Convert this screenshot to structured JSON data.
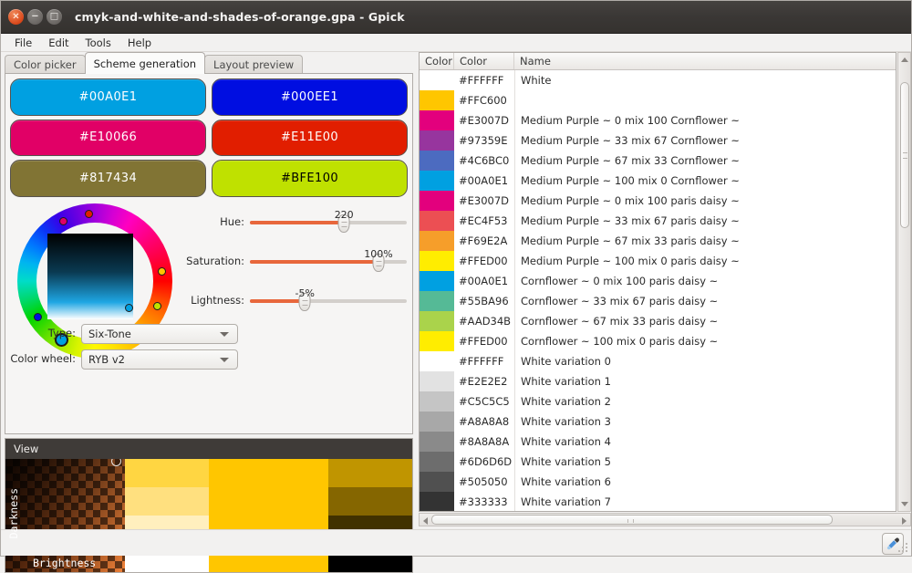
{
  "window": {
    "title": "cmyk-and-white-and-shades-of-orange.gpa - Gpick",
    "close_label": "×",
    "minimize_label": "−",
    "maximize_label": "□"
  },
  "menu": {
    "items": [
      "File",
      "Edit",
      "Tools",
      "Help"
    ]
  },
  "tabs": [
    {
      "label": "Color picker",
      "active": false
    },
    {
      "label": "Scheme generation",
      "active": true
    },
    {
      "label": "Layout preview",
      "active": false
    }
  ],
  "scheme": {
    "swatches": [
      {
        "hex": "#00A0E1",
        "text_color": "#ffffff"
      },
      {
        "hex": "#000EE1",
        "text_color": "#ffffff"
      },
      {
        "hex": "#E10066",
        "text_color": "#ffffff"
      },
      {
        "hex": "#E11E00",
        "text_color": "#ffffff"
      },
      {
        "hex": "#817434",
        "text_color": "#ffffff"
      },
      {
        "hex": "#BFE100",
        "text_color": "#000000"
      }
    ],
    "wheel": {
      "markers": [
        {
          "angle": 118,
          "color": "#E10066",
          "selected": false
        },
        {
          "angle": 95,
          "color": "#E11E00",
          "selected": false
        },
        {
          "angle": 8,
          "color": "#FFC400",
          "selected": false
        },
        {
          "angle": 338,
          "color": "#BFE100",
          "selected": false
        },
        {
          "angle": 212,
          "color": "#000EE1",
          "selected": false
        },
        {
          "angle": 240,
          "color": "#00A0E1",
          "selected": true
        }
      ],
      "square_marker": {
        "color": "#00A0E1"
      }
    },
    "controls": [
      {
        "name": "hue",
        "label": "Hue:",
        "value": "220",
        "percent": 60
      },
      {
        "name": "saturation",
        "label": "Saturation:",
        "value": "100%",
        "percent": 82
      },
      {
        "name": "lightness",
        "label": "Lightness:",
        "value": "-5%",
        "percent": 35
      }
    ],
    "type": {
      "label": "Type:",
      "value": "Six-Tone"
    },
    "color_wheel": {
      "label": "Color wheel:",
      "value": "RYB v2"
    }
  },
  "view": {
    "header": "View",
    "darkness_label": "Darkness",
    "brightness_label": "Brightness",
    "tints": [
      "#FFD642",
      "#FFE07F",
      "#FFEFBE",
      "#FFFFFF"
    ],
    "base": "#FFC600",
    "shades": [
      "#C09500",
      "#856600",
      "#403100",
      "#000000"
    ]
  },
  "color_list": {
    "headers": [
      "Color",
      "Color",
      "Name"
    ],
    "rows": [
      {
        "hex": "#FFFFFF",
        "name": "White"
      },
      {
        "hex": "#FFC600",
        "name": ""
      },
      {
        "hex": "#E3007D",
        "name": "Medium Purple ~ 0 mix 100 Cornflower ~"
      },
      {
        "hex": "#97359E",
        "name": "Medium Purple ~ 33 mix 67 Cornflower ~"
      },
      {
        "hex": "#4C6BC0",
        "name": "Medium Purple ~ 67 mix 33 Cornflower ~"
      },
      {
        "hex": "#00A0E1",
        "name": "Medium Purple ~ 100 mix 0 Cornflower ~"
      },
      {
        "hex": "#E3007D",
        "name": "Medium Purple ~ 0 mix 100 paris daisy ~"
      },
      {
        "hex": "#EC4F53",
        "name": "Medium Purple ~ 33 mix 67 paris daisy ~"
      },
      {
        "hex": "#F69E2A",
        "name": "Medium Purple ~ 67 mix 33 paris daisy ~"
      },
      {
        "hex": "#FFED00",
        "name": "Medium Purple ~ 100 mix 0 paris daisy ~"
      },
      {
        "hex": "#00A0E1",
        "name": "Cornflower ~ 0 mix 100 paris daisy ~"
      },
      {
        "hex": "#55BA96",
        "name": "Cornflower ~ 33 mix 67 paris daisy ~"
      },
      {
        "hex": "#AAD34B",
        "name": "Cornflower ~ 67 mix 33 paris daisy ~"
      },
      {
        "hex": "#FFED00",
        "name": "Cornflower ~ 100 mix 0 paris daisy ~"
      },
      {
        "hex": "#FFFFFF",
        "name": "White variation 0"
      },
      {
        "hex": "#E2E2E2",
        "name": "White variation 1"
      },
      {
        "hex": "#C5C5C5",
        "name": "White variation 2"
      },
      {
        "hex": "#A8A8A8",
        "name": "White variation 3"
      },
      {
        "hex": "#8A8A8A",
        "name": "White variation 4"
      },
      {
        "hex": "#6D6D6D",
        "name": "White variation 5"
      },
      {
        "hex": "#505050",
        "name": "White variation 6"
      },
      {
        "hex": "#333333",
        "name": "White variation 7"
      }
    ]
  },
  "statusbar": {
    "picker_icon": "eyedropper-icon"
  }
}
